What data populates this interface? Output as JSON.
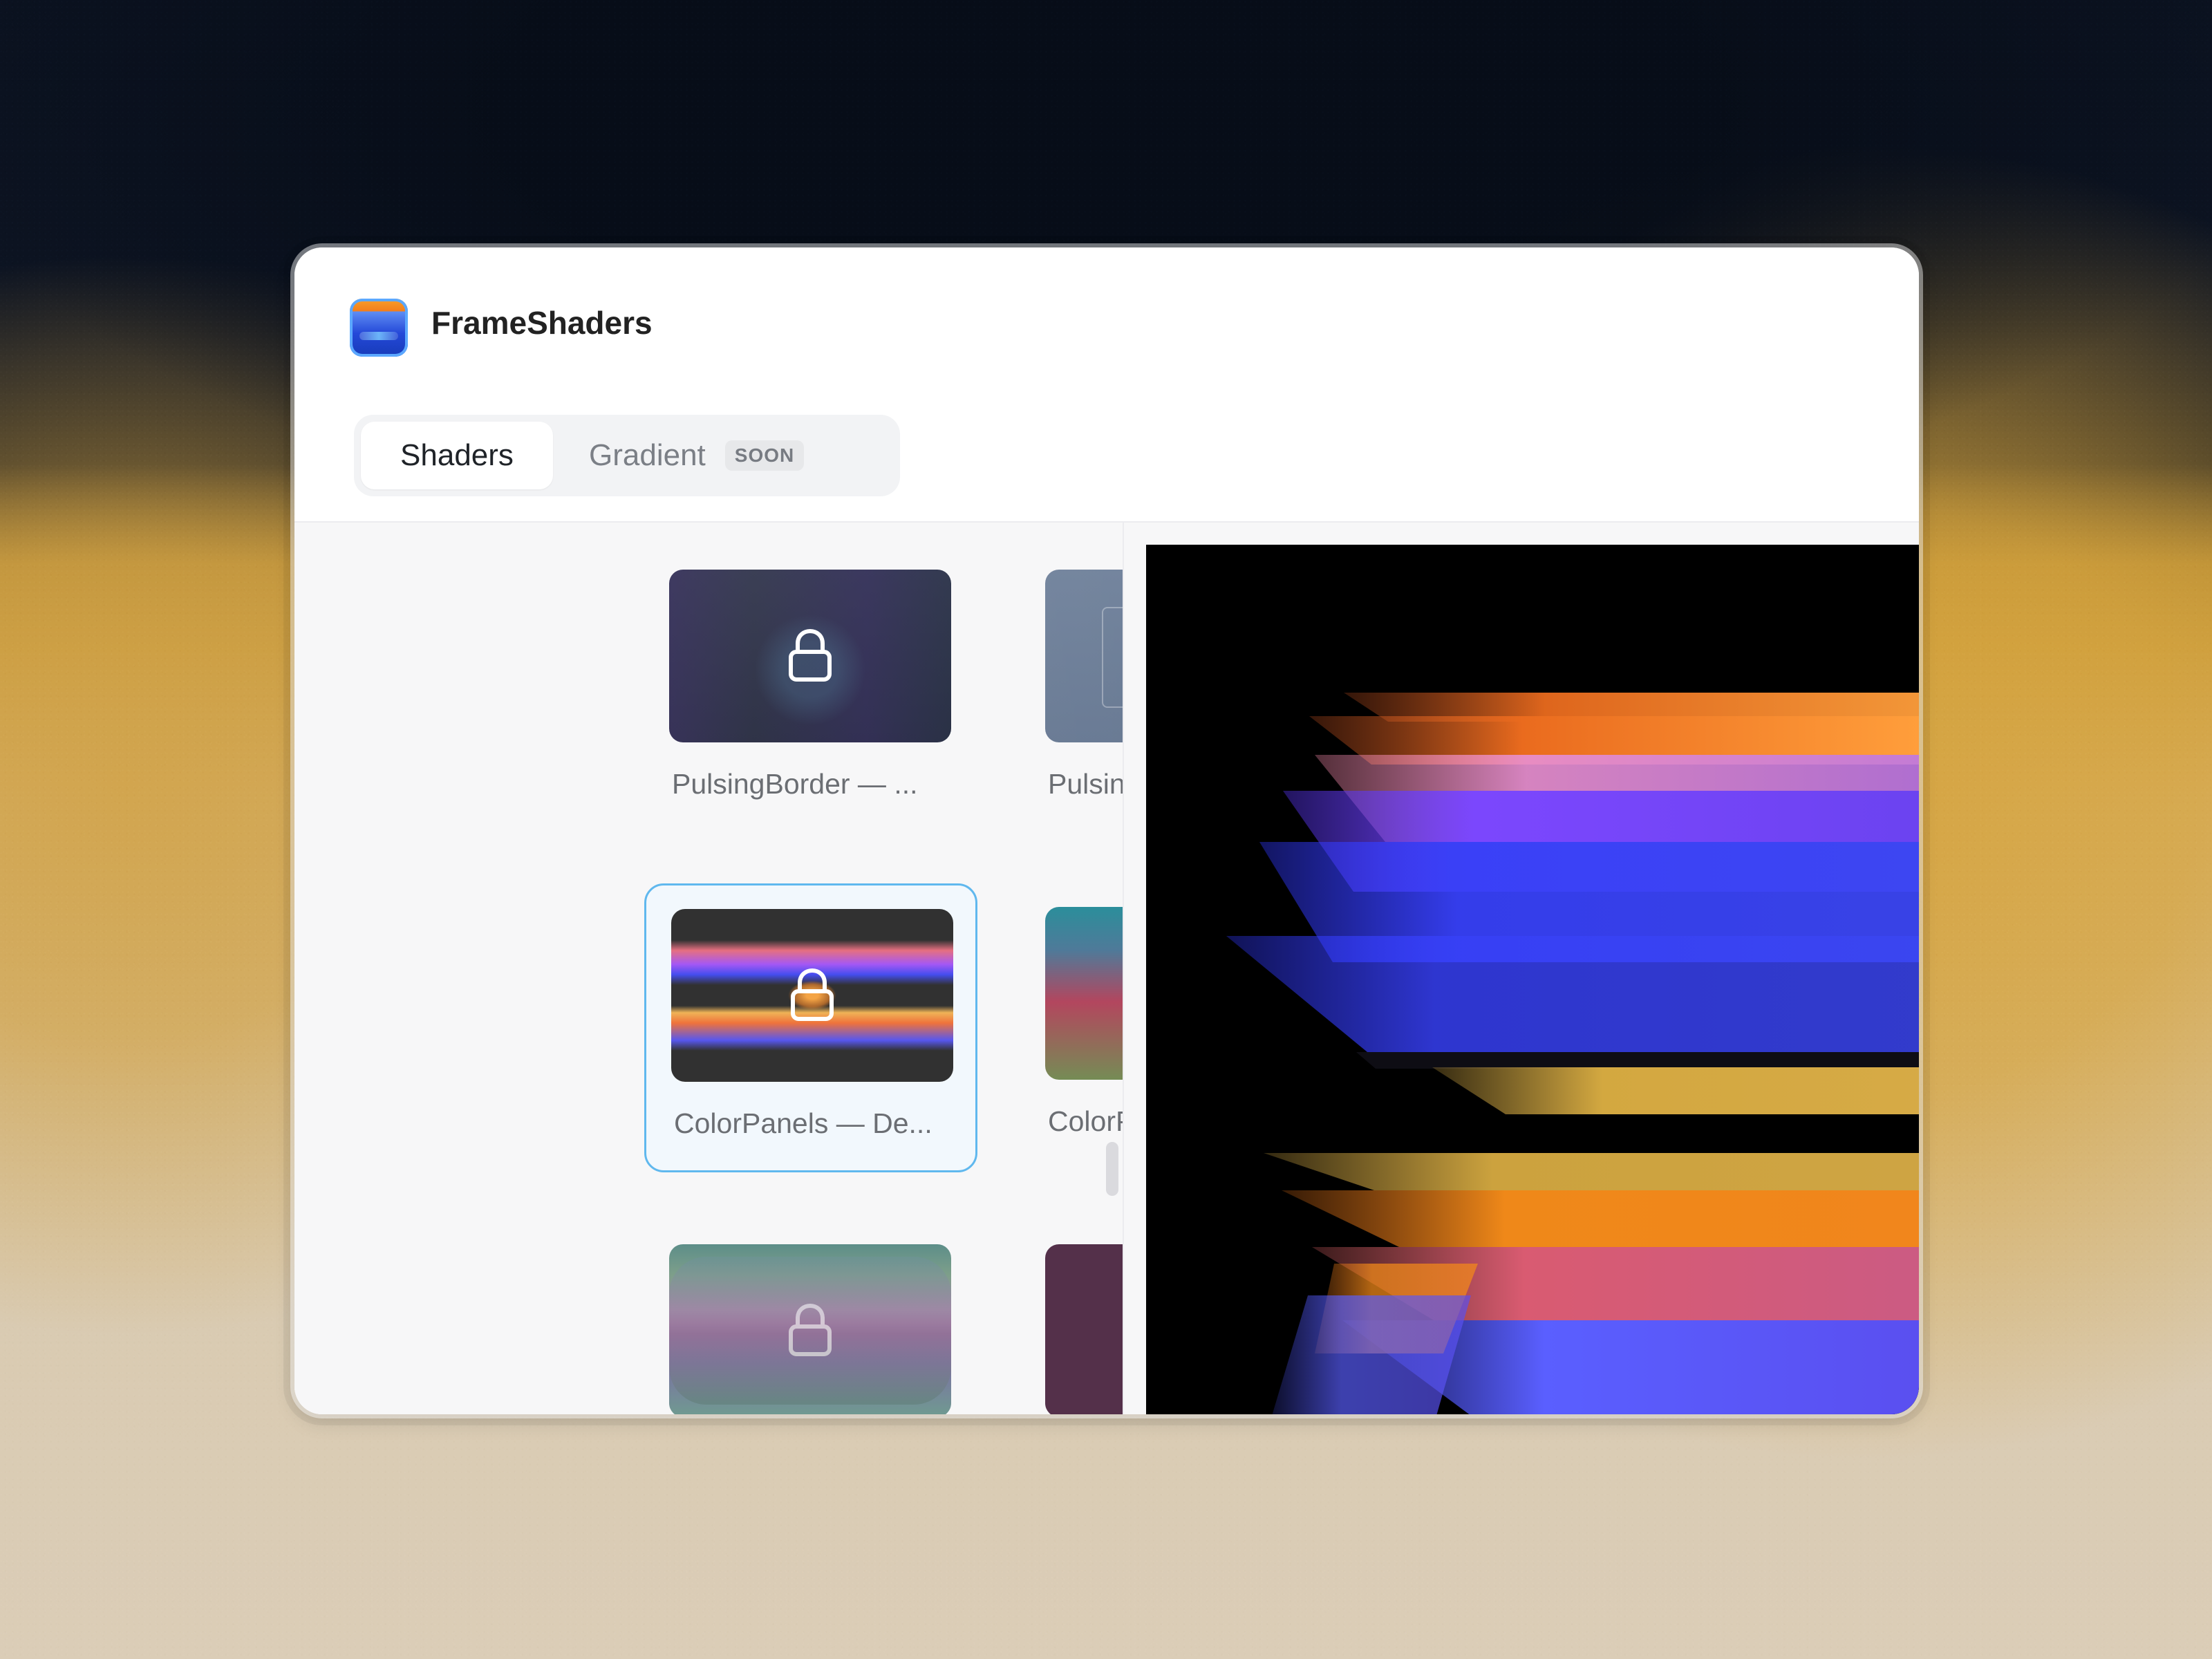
{
  "app": {
    "title": "FrameShaders"
  },
  "tabs": {
    "shaders": "Shaders",
    "gradient": "Gradient",
    "gradient_badge": "SOON"
  },
  "library": {
    "items": [
      {
        "label": "PulsingBorder — ...",
        "locked": true,
        "selected": false
      },
      {
        "label": "PulsingBorder — S...",
        "locked": true,
        "selected": false
      },
      {
        "label": "ColorPanels — De...",
        "locked": true,
        "selected": true
      },
      {
        "label": "ColorPanels — Gla...",
        "locked": true,
        "selected": false
      },
      {
        "label": "",
        "locked": true,
        "selected": false
      },
      {
        "label": "",
        "locked": true,
        "selected": false
      }
    ]
  },
  "icons": {
    "app_logo": "frameshaders-logo-icon",
    "lock": "lock-icon"
  },
  "colors": {
    "selection": "#60b8ee",
    "preview_background": "#000000",
    "orange": "#f28a1c",
    "violet": "#7b3cf0",
    "blue": "#3f49f3",
    "yellow": "#f0c24c"
  }
}
